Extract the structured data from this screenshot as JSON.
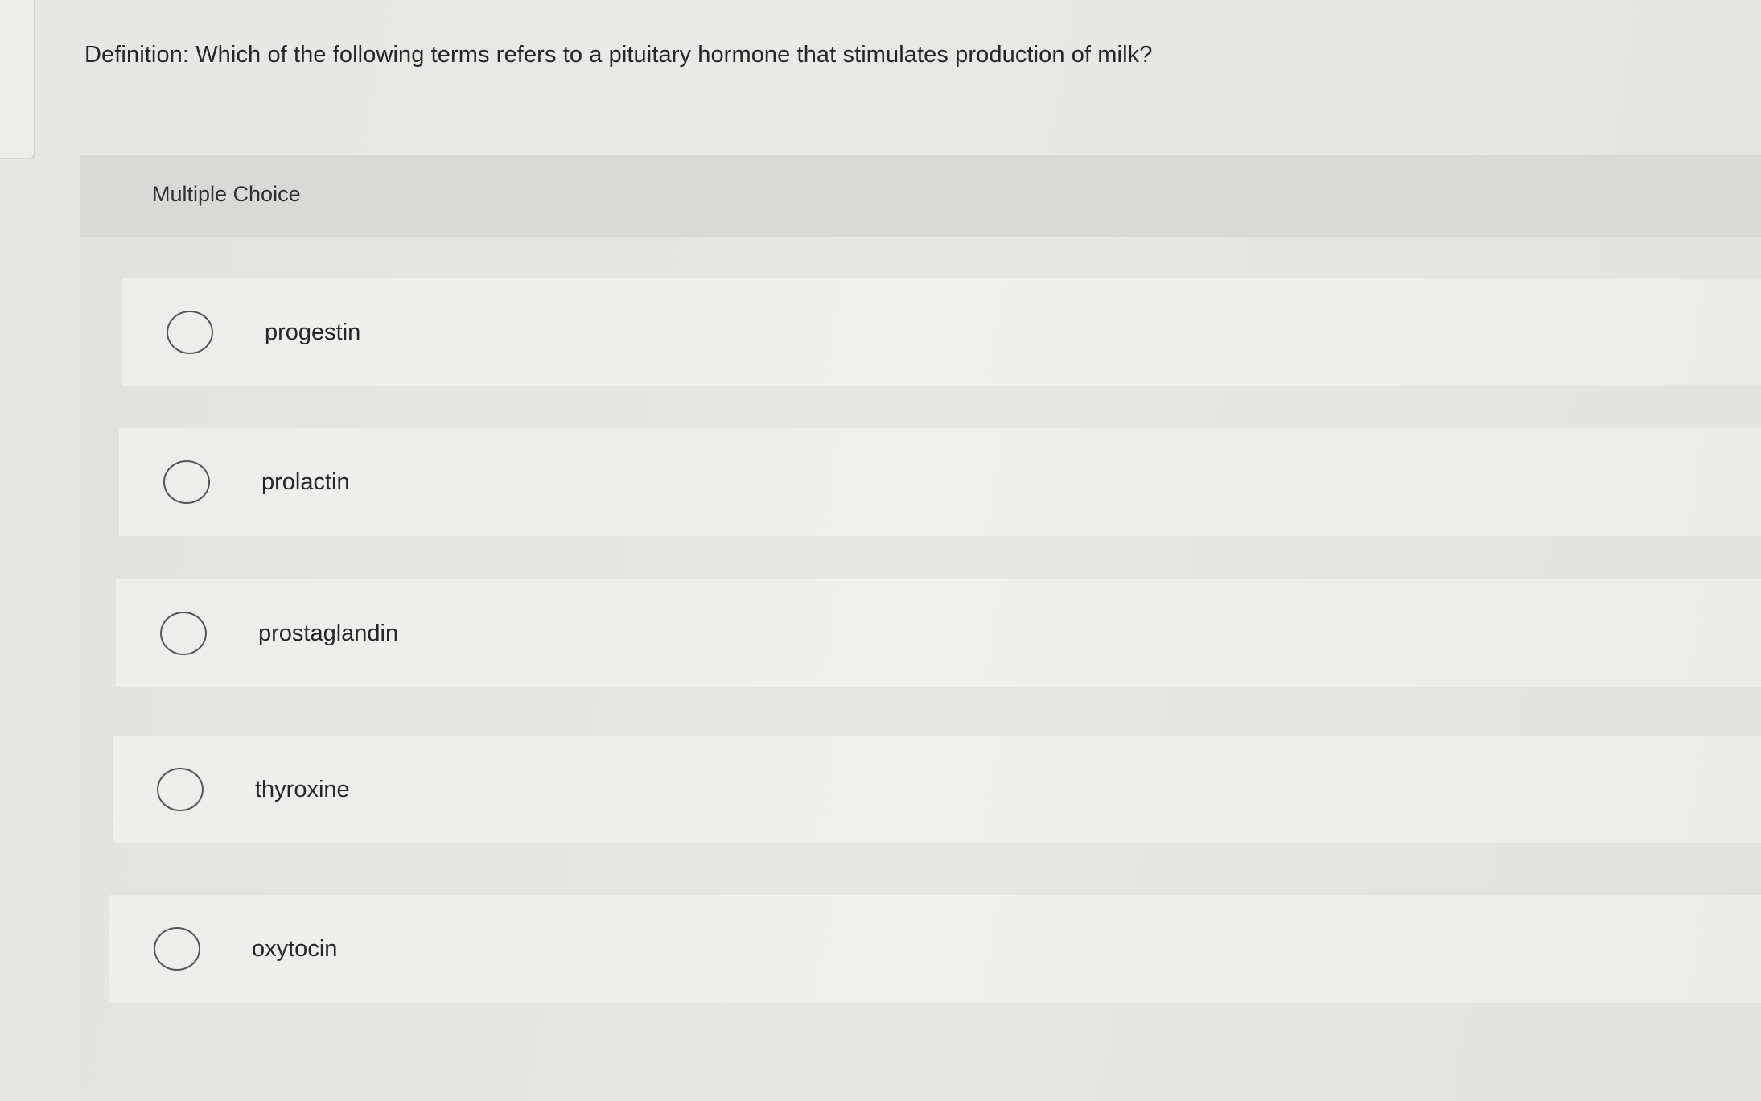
{
  "question": {
    "text": "Definition: Which of the following terms refers to a pituitary hormone that stimulates production of milk?"
  },
  "panel": {
    "header_label": "Multiple Choice"
  },
  "options": [
    {
      "label": "progestin"
    },
    {
      "label": "prolactin"
    },
    {
      "label": "prostaglandin"
    },
    {
      "label": "thyroxine"
    },
    {
      "label": "oxytocin"
    }
  ]
}
